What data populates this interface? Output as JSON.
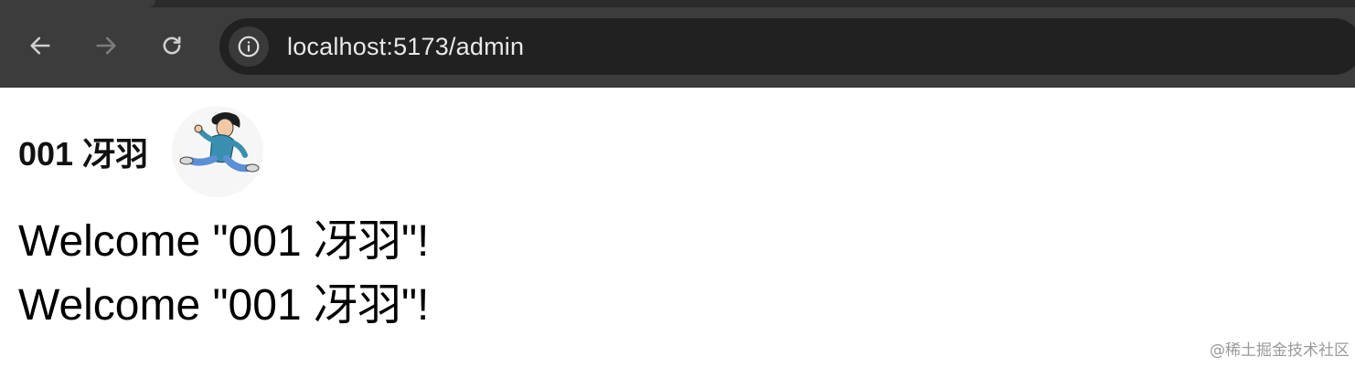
{
  "browser": {
    "url": "localhost:5173/admin",
    "icons": {
      "back": "arrow-left-icon",
      "forward": "arrow-right-icon",
      "reload": "reload-icon",
      "site_info": "info-icon"
    },
    "colors": {
      "toolbar_bg": "#3c3c3c",
      "omnibox_bg": "#212121",
      "url_text": "#e8e8e8"
    }
  },
  "page": {
    "user_name": "001 冴羽",
    "avatar": "running-cartoon-character-avatar",
    "welcome_lines": [
      "Welcome \"001 冴羽\"!",
      "Welcome \"001 冴羽\"!"
    ],
    "watermark": "@稀土掘金技术社区"
  }
}
